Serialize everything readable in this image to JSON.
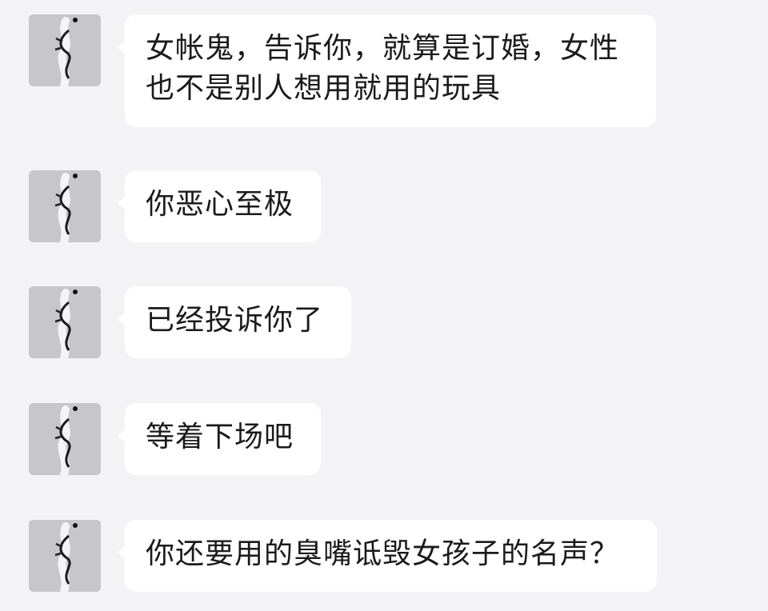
{
  "colors": {
    "background": "#f3f3f5",
    "bubble": "#ffffff",
    "text": "#1b1b1b"
  },
  "avatar_icon": "avatar-image",
  "messages": [
    {
      "text": "女帐鬼，告诉你，就算是订婚，女性\n也不是别人想用就用的玩具"
    },
    {
      "text": "你恶心至极"
    },
    {
      "text": "已经投诉你了"
    },
    {
      "text": "等着下场吧"
    },
    {
      "text": "你还要用的臭嘴诋毁女孩子的名声？"
    }
  ]
}
